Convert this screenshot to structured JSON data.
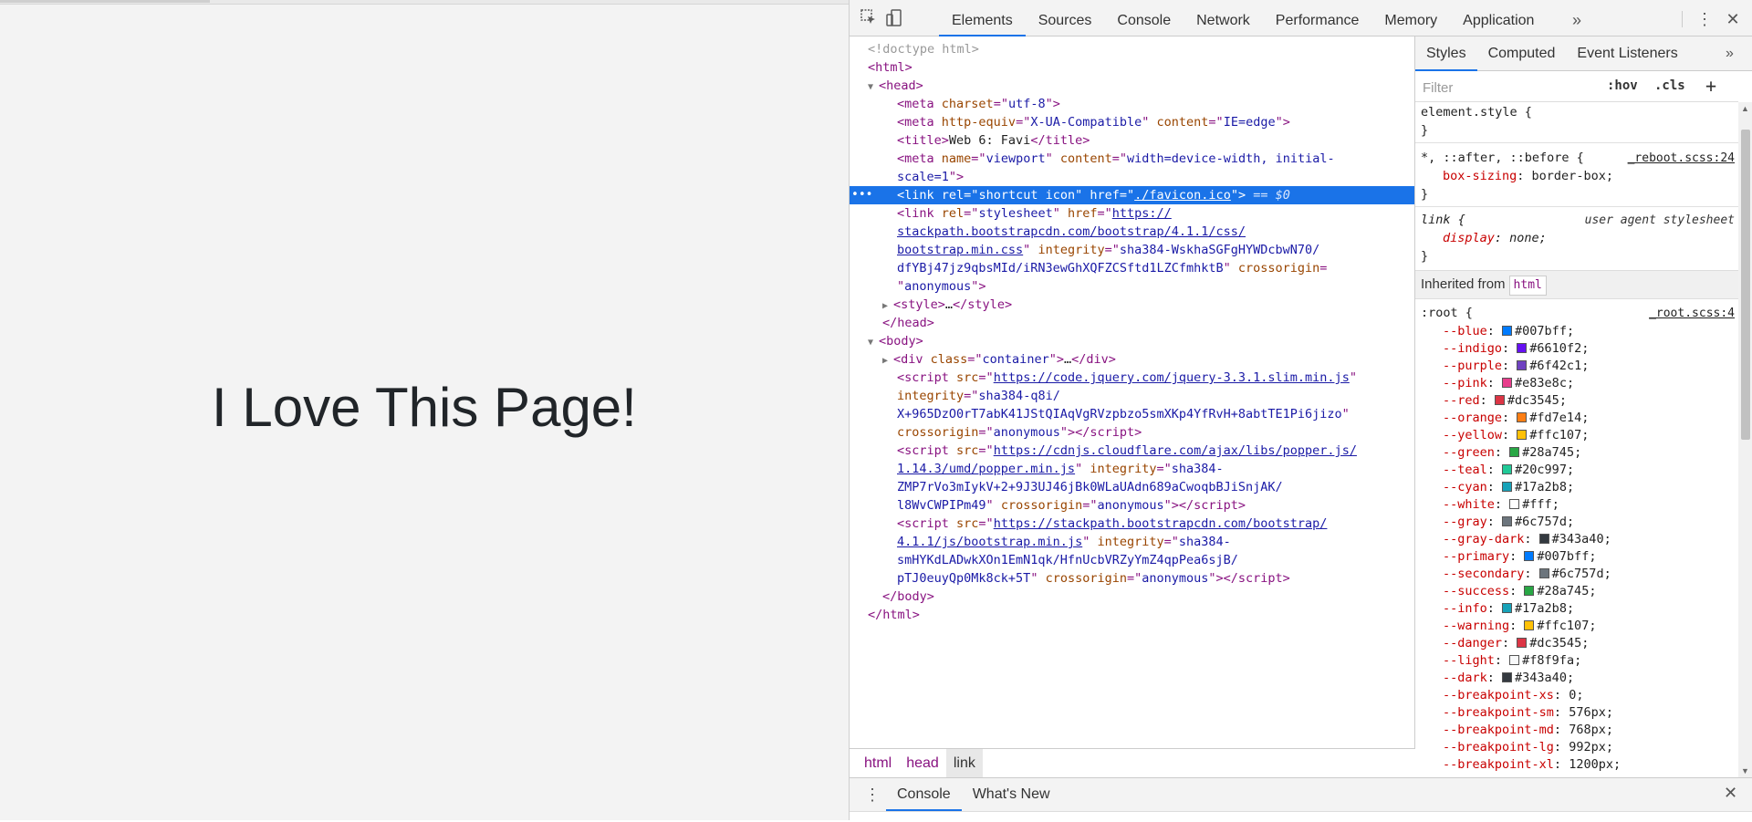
{
  "page": {
    "heading": "I Love This Page!"
  },
  "devtools": {
    "panel_tabs": [
      "Elements",
      "Sources",
      "Console",
      "Network",
      "Performance",
      "Memory",
      "Application"
    ],
    "active_panel": "Elements",
    "more_tabs": "»",
    "icons": {
      "inspect": "inspect-element-icon",
      "device": "device-toolbar-icon",
      "kebab": "vertical-dots-icon",
      "close": "close-icon"
    }
  },
  "elements": {
    "selected_marker": "== $0",
    "breadcrumb": [
      "html",
      "head",
      "link"
    ]
  },
  "styles": {
    "tabs": [
      "Styles",
      "Computed",
      "Event Listeners"
    ],
    "more_tabs": "»",
    "filter_placeholder": "Filter",
    "hov": ":hov",
    "cls": ".cls",
    "add": "+",
    "element_style": "element.style {",
    "reboot_selector": "*, ::after, ::before {",
    "reboot_source": "_reboot.scss:24",
    "box_sizing_name": "box-sizing",
    "box_sizing_value": "border-box",
    "link_selector": "link {",
    "link_source": "user agent stylesheet",
    "display_name": "display",
    "display_value": "none",
    "inherited_label": "Inherited from",
    "inherited_tag": "html",
    "root_selector": ":root {",
    "root_source": "_root.scss:4",
    "root_vars": [
      {
        "name": "--blue",
        "value": "#007bff",
        "color": "#007bff"
      },
      {
        "name": "--indigo",
        "value": "#6610f2",
        "color": "#6610f2"
      },
      {
        "name": "--purple",
        "value": "#6f42c1",
        "color": "#6f42c1"
      },
      {
        "name": "--pink",
        "value": "#e83e8c",
        "color": "#e83e8c"
      },
      {
        "name": "--red",
        "value": "#dc3545",
        "color": "#dc3545"
      },
      {
        "name": "--orange",
        "value": "#fd7e14",
        "color": "#fd7e14"
      },
      {
        "name": "--yellow",
        "value": "#ffc107",
        "color": "#ffc107"
      },
      {
        "name": "--green",
        "value": "#28a745",
        "color": "#28a745"
      },
      {
        "name": "--teal",
        "value": "#20c997",
        "color": "#20c997"
      },
      {
        "name": "--cyan",
        "value": "#17a2b8",
        "color": "#17a2b8"
      },
      {
        "name": "--white",
        "value": "#fff",
        "color": "#ffffff"
      },
      {
        "name": "--gray",
        "value": "#6c757d",
        "color": "#6c757d"
      },
      {
        "name": "--gray-dark",
        "value": "#343a40",
        "color": "#343a40"
      },
      {
        "name": "--primary",
        "value": "#007bff",
        "color": "#007bff"
      },
      {
        "name": "--secondary",
        "value": "#6c757d",
        "color": "#6c757d"
      },
      {
        "name": "--success",
        "value": "#28a745",
        "color": "#28a745"
      },
      {
        "name": "--info",
        "value": "#17a2b8",
        "color": "#17a2b8"
      },
      {
        "name": "--warning",
        "value": "#ffc107",
        "color": "#ffc107"
      },
      {
        "name": "--danger",
        "value": "#dc3545",
        "color": "#dc3545"
      },
      {
        "name": "--light",
        "value": "#f8f9fa",
        "color": "#f8f9fa"
      },
      {
        "name": "--dark",
        "value": "#343a40",
        "color": "#343a40"
      },
      {
        "name": "--breakpoint-xs",
        "value": "0",
        "color": null
      },
      {
        "name": "--breakpoint-sm",
        "value": "576px",
        "color": null
      },
      {
        "name": "--breakpoint-md",
        "value": "768px",
        "color": null
      },
      {
        "name": "--breakpoint-lg",
        "value": "992px",
        "color": null
      },
      {
        "name": "--breakpoint-xl",
        "value": "1200px",
        "color": null
      }
    ]
  },
  "drawer": {
    "tabs": [
      "Console",
      "What's New"
    ],
    "active_tab": "Console"
  },
  "colors": {
    "accent": "#1a73e8",
    "selection": "#1a73e8"
  }
}
